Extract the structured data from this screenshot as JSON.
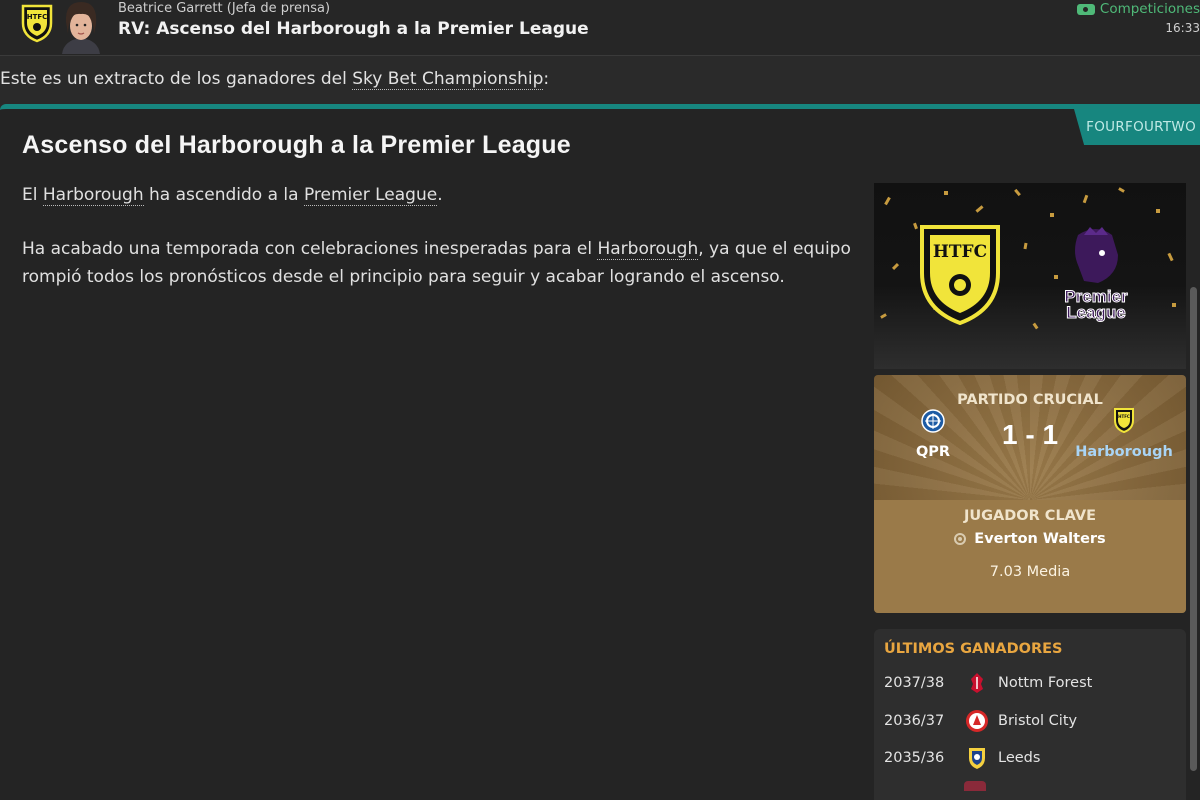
{
  "header": {
    "sender": "Beatrice Garrett  (Jefa de prensa)",
    "subject": "RV: Ascenso del Harborough a la Premier League",
    "competitions_link": "Competiciones",
    "time": "16:33",
    "club_badge_text": "HTFC"
  },
  "intro": {
    "prefix": "Este es un extracto de los ganadores del ",
    "competition": "Sky Bet Championship",
    "suffix": ":"
  },
  "article": {
    "source": "FOURFOURTWO",
    "headline": "Ascenso del Harborough a la Premier League",
    "p1": {
      "a": "El ",
      "club": "Harborough",
      "b": " ha ascendido a la ",
      "league": "Premier League",
      "c": "."
    },
    "p2": {
      "a": "Ha acabado una temporada con celebraciones inesperadas para el ",
      "club": "Harborough",
      "b": ", ya que el equipo rompió todos los pronósticos desde el principio para seguir y acabar logrando el ascenso."
    }
  },
  "promo": {
    "club_badge_text": "HTFC",
    "league_logo_line1": "Premier",
    "league_logo_line2": "League"
  },
  "match": {
    "label": "PARTIDO CRUCIAL",
    "home_team": "QPR",
    "away_team": "Harborough",
    "score": "1 - 1",
    "away_badge_text": "HTFC"
  },
  "key_player": {
    "label": "JUGADOR CLAVE",
    "name": "Everton Walters",
    "rating": "7.03 Media"
  },
  "winners": {
    "title": "ÚLTIMOS GANADORES",
    "rows": [
      {
        "season": "2037/38",
        "team": "Nottm Forest",
        "badge_color": "#c8102e"
      },
      {
        "season": "2036/37",
        "team": "Bristol City",
        "badge_color": "#d62828"
      },
      {
        "season": "2035/36",
        "team": "Leeds",
        "badge_color": "#f4d03f"
      }
    ]
  },
  "colors": {
    "accent_teal": "#17867f",
    "link_green": "#4fb978",
    "winners_orange": "#e9a640",
    "card_gold": "#9a7a49"
  }
}
